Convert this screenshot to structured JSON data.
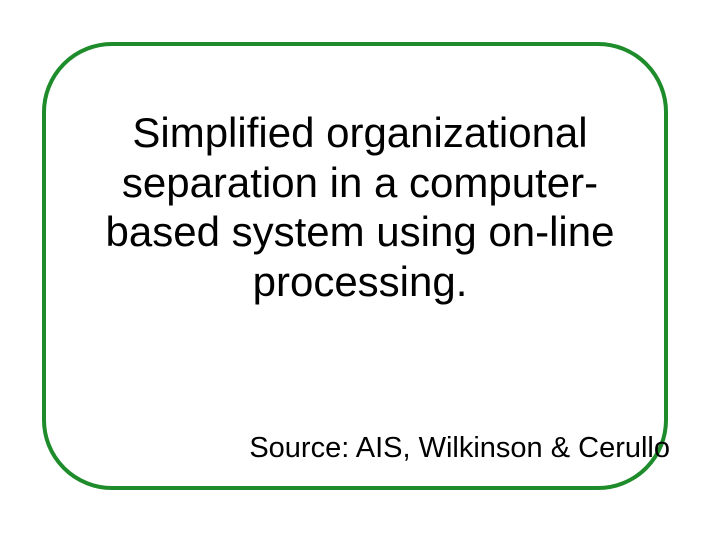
{
  "slide": {
    "title": "Simplified organizational separation in a computer-based system using on-line processing.",
    "source": "Source: AIS, Wilkinson & Cerullo"
  },
  "colors": {
    "border": "#1e8c2b",
    "text": "#000000",
    "background": "#ffffff"
  }
}
